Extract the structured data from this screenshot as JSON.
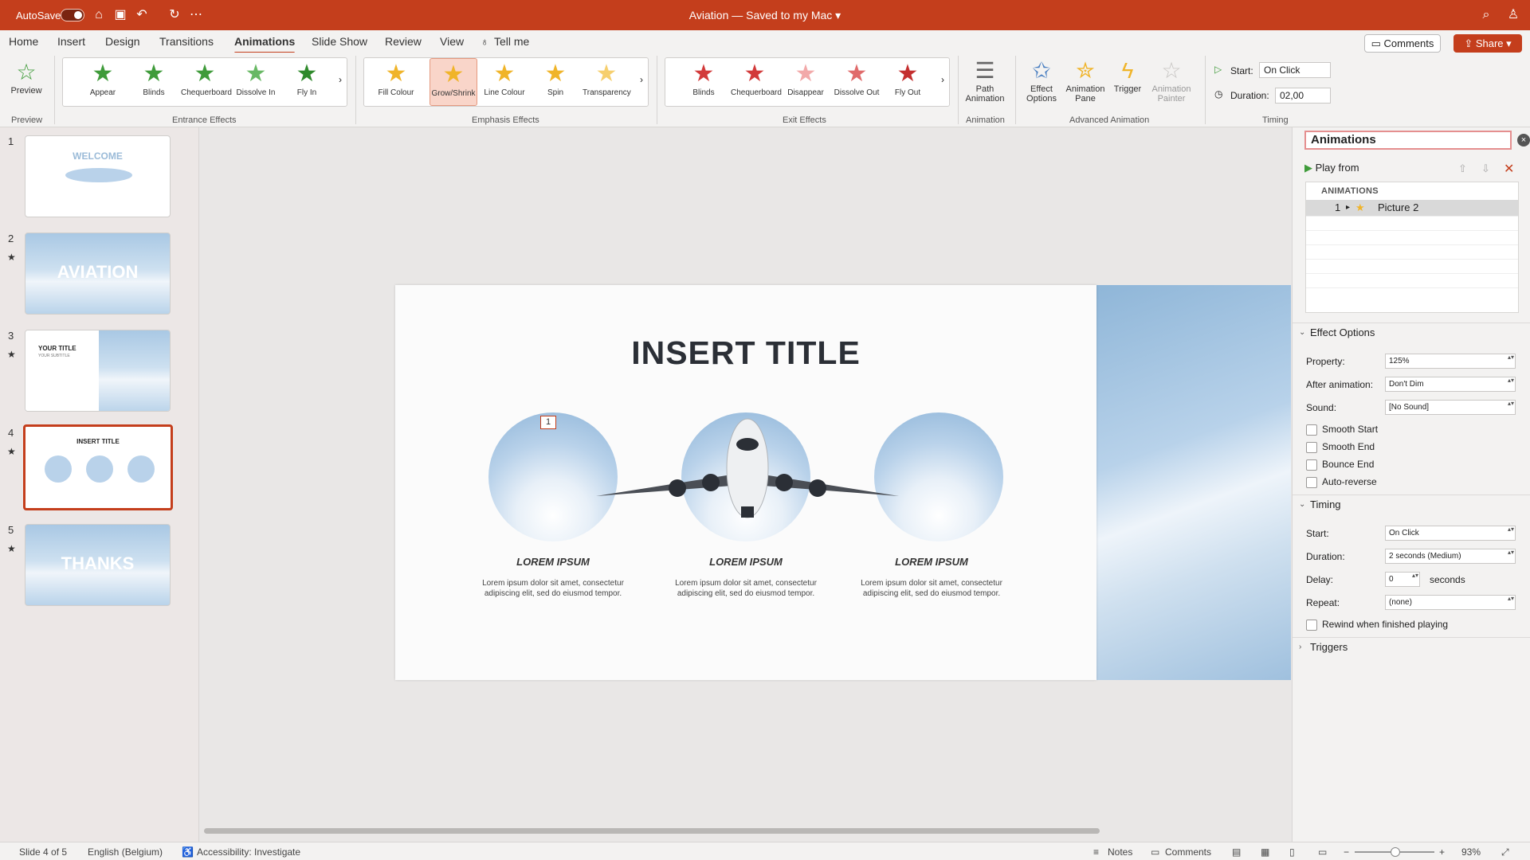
{
  "titlebar": {
    "autosave_label": "AutoSave",
    "document_title": "Aviation — Saved to my Mac",
    "icons": [
      "home-icon",
      "save-icon",
      "undo-icon",
      "redo-icon",
      "more-icon",
      "search-icon",
      "profile-icon"
    ]
  },
  "menu": {
    "tabs": [
      "Home",
      "Insert",
      "Design",
      "Transitions",
      "Animations",
      "Slide Show",
      "Review",
      "View",
      "Tell me"
    ],
    "active_tab": "Animations",
    "comments_label": "Comments",
    "share_label": "Share"
  },
  "ribbon": {
    "preview_label": "Preview",
    "preview_group": "Preview",
    "entrance": {
      "label": "Entrance Effects",
      "items": [
        "Appear",
        "Blinds",
        "Chequerboard",
        "Dissolve In",
        "Fly In"
      ]
    },
    "emphasis": {
      "label": "Emphasis Effects",
      "items": [
        "Fill Colour",
        "Grow/Shrink",
        "Line Colour",
        "Spin",
        "Transparency"
      ],
      "selected": "Grow/Shrink"
    },
    "exit": {
      "label": "Exit Effects",
      "items": [
        "Blinds",
        "Chequerboard",
        "Disappear",
        "Dissolve Out",
        "Fly Out"
      ]
    },
    "path_animation": "Path Animation",
    "animation_group": "Animation",
    "effect_options": "Effect Options",
    "animation_pane": "Animation Pane",
    "trigger": "Trigger",
    "animation_painter": "Animation Painter",
    "advanced_group": "Advanced Animation",
    "start_label": "Start:",
    "start_value": "On Click",
    "duration_label": "Duration:",
    "duration_value": "02,00",
    "timing_group": "Timing"
  },
  "slides": {
    "numbers": [
      "1",
      "2",
      "3",
      "4",
      "5"
    ],
    "thumb1_text": "WELCOME",
    "thumb2_text": "AVIATION",
    "thumb3_title": "YOUR TITLE",
    "thumb3_sub": "YOUR SUBTITLE",
    "thumb4_title": "INSERT TITLE",
    "thumb5_text": "THANKS",
    "selected": 4
  },
  "slide": {
    "title": "INSERT TITLE",
    "anim_tag": "1",
    "columns": [
      {
        "heading": "LOREM IPSUM",
        "text": "Lorem ipsum dolor sit amet, consectetur adipiscing elit, sed do eiusmod tempor."
      },
      {
        "heading": "LOREM IPSUM",
        "text": "Lorem ipsum dolor sit amet, consectetur adipiscing elit, sed do eiusmod tempor."
      },
      {
        "heading": "LOREM IPSUM",
        "text": "Lorem ipsum dolor sit amet, consectetur adipiscing elit, sed do eiusmod tempor."
      }
    ]
  },
  "pane": {
    "title": "Animations",
    "play_from": "Play from",
    "list_header": "ANIMATIONS",
    "item_number": "1",
    "item_name": "Picture 2",
    "effect_options_section": "Effect Options",
    "property_label": "Property:",
    "property_value": "125%",
    "after_anim_label": "After animation:",
    "after_anim_value": "Don't Dim",
    "sound_label": "Sound:",
    "sound_value": "[No Sound]",
    "checks": [
      "Smooth Start",
      "Smooth End",
      "Bounce End",
      "Auto-reverse"
    ],
    "timing_section": "Timing",
    "start_label": "Start:",
    "start_value": "On Click",
    "duration_label": "Duration:",
    "duration_value": "2 seconds (Medium)",
    "delay_label": "Delay:",
    "delay_value": "0",
    "delay_unit": "seconds",
    "repeat_label": "Repeat:",
    "repeat_value": "(none)",
    "rewind_label": "Rewind when finished playing",
    "triggers_section": "Triggers"
  },
  "statusbar": {
    "slide_info": "Slide 4 of 5",
    "language": "English (Belgium)",
    "accessibility": "Accessibility: Investigate",
    "notes": "Notes",
    "comments": "Comments",
    "zoom": "93%"
  },
  "colors": {
    "accent": "#c43e1c",
    "green_star": "#3f9b3a",
    "yellow_star": "#f0b429",
    "red_star": "#d23a3a"
  }
}
